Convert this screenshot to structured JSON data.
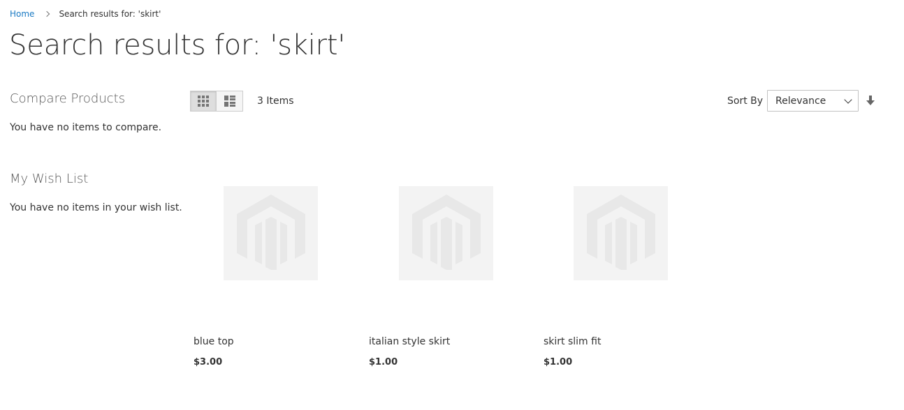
{
  "breadcrumbs": {
    "home": "Home",
    "current": "Search results for: 'skirt'"
  },
  "page": {
    "title": "Search results for: 'skirt'"
  },
  "sidebar": {
    "compare": {
      "title": "Compare Products",
      "empty": "You have no items to compare."
    },
    "wishlist": {
      "title": "My Wish List",
      "empty": "You have no items in your wish list."
    }
  },
  "toolbar": {
    "modes": [
      {
        "name": "grid",
        "icon": "grid-icon",
        "active": true
      },
      {
        "name": "list",
        "icon": "list-icon",
        "active": false
      }
    ],
    "amount": "3 Items",
    "sort_label": "Sort By",
    "sort_value": "Relevance",
    "sort_direction_icon": "arrow-down-icon"
  },
  "products": [
    {
      "name": "blue top",
      "price": "$3.00",
      "image_icon": "magento-placeholder-icon"
    },
    {
      "name": "italian style skirt",
      "price": "$1.00",
      "image_icon": "magento-placeholder-icon"
    },
    {
      "name": "skirt slim fit",
      "price": "$1.00",
      "image_icon": "magento-placeholder-icon"
    }
  ],
  "colors": {
    "link": "#1979c3",
    "text": "#333333",
    "placeholder_bg": "#f3f3f3",
    "placeholder_logo": "#e6e6e6"
  }
}
